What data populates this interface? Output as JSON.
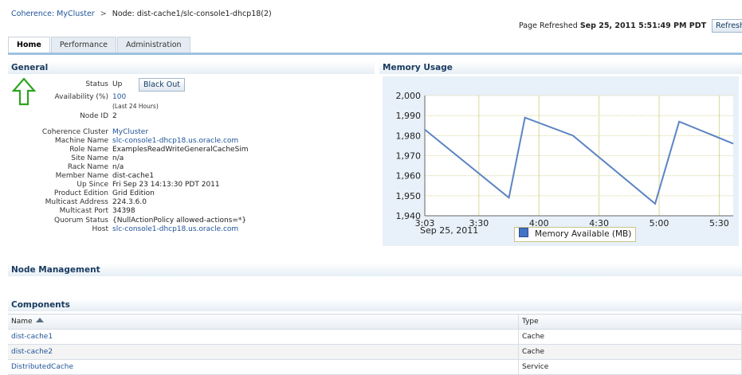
{
  "breadcrumb": {
    "root": "Coherence: MyCluster",
    "separator": ">",
    "current": "Node: dist-cache1/slc-console1-dhcp18(2)"
  },
  "refresh": {
    "prefix": "Page Refreshed",
    "timestamp": "Sep 25, 2011 5:51:49 PM PDT",
    "button_label": "Refresh"
  },
  "tabs": [
    {
      "label": "Home",
      "active": true
    },
    {
      "label": "Performance",
      "active": false
    },
    {
      "label": "Administration",
      "active": false
    }
  ],
  "general": {
    "title": "General",
    "status_label": "Status",
    "status_value": "Up",
    "blackout_label": "Black Out",
    "availability_label": "Availability (%)",
    "availability_value": "100",
    "availability_note": "(Last 24 Hours)",
    "node_id_label": "Node ID",
    "node_id_value": "2",
    "properties": [
      {
        "label": "Coherence Cluster",
        "value": "MyCluster",
        "link": true
      },
      {
        "label": "Machine Name",
        "value": "slc-console1-dhcp18.us.oracle.com",
        "link": true
      },
      {
        "label": "Role Name",
        "value": "ExamplesReadWriteGeneralCacheSim",
        "link": false
      },
      {
        "label": "Site Name",
        "value": "n/a",
        "link": false
      },
      {
        "label": "Rack Name",
        "value": "n/a",
        "link": false
      },
      {
        "label": "Member Name",
        "value": "dist-cache1",
        "link": false
      },
      {
        "label": "Up Since",
        "value": "Fri Sep 23 14:13:30 PDT 2011",
        "link": false
      },
      {
        "label": "Product Edition",
        "value": "Grid Edition",
        "link": false
      },
      {
        "label": "Multicast Address",
        "value": "224.3.6.0",
        "link": false
      },
      {
        "label": "Multicast Port",
        "value": "34398",
        "link": false
      },
      {
        "label": "Quorum Status",
        "value": "{NullActionPolicy allowed-actions=*}",
        "link": false
      },
      {
        "label": "Host",
        "value": "slc-console1-dhcp18.us.oracle.com",
        "link": true
      }
    ]
  },
  "memory": {
    "title": "Memory Usage",
    "date_label": "Sep 25, 2011",
    "legend": "Memory Available (MB)"
  },
  "chart_data": {
    "type": "line",
    "ylim": [
      1940,
      2000
    ],
    "yticks": [
      "1,940",
      "1,950",
      "1,960",
      "1,970",
      "1,980",
      "1,990",
      "2,000"
    ],
    "xlim": [
      "3:03",
      "5:37"
    ],
    "xticks": [
      "3:03",
      "3:30",
      "4:00",
      "4:30",
      "5:00",
      "5:30"
    ],
    "grid": true,
    "legend_position": "bottom",
    "series": [
      {
        "name": "Memory Available (MB)",
        "color": "#5b84c4",
        "x": [
          "3:03",
          "3:45",
          "3:53",
          "4:17",
          "4:58",
          "5:10",
          "5:37"
        ],
        "y": [
          1983,
          1949,
          1989,
          1980,
          1946,
          1987,
          1976
        ]
      }
    ]
  },
  "node_management": {
    "title": "Node Management"
  },
  "components": {
    "title": "Components",
    "columns": [
      "Name",
      "Type"
    ],
    "rows": [
      {
        "name": "dist-cache1",
        "type": "Cache"
      },
      {
        "name": "dist-cache2",
        "type": "Cache"
      },
      {
        "name": "DistributedCache",
        "type": "Service"
      }
    ]
  }
}
